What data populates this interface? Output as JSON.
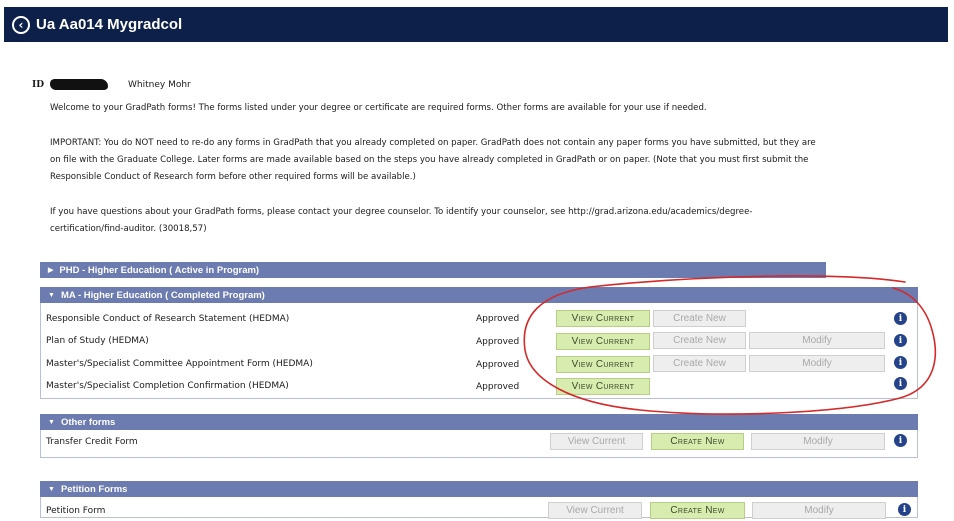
{
  "app": {
    "title": "Ua Aa014 Mygradcol"
  },
  "identity": {
    "id_label": "ID",
    "name": "Whitney Mohr"
  },
  "intro": {
    "welcome": "Welcome to your GradPath forms! The forms listed under your degree or certificate are required forms. Other forms are available for your use if needed.",
    "important": "IMPORTANT: You do NOT need to re-do any forms in GradPath that you already completed on paper. GradPath does not contain any paper forms you have submitted, but they are on file with the Graduate College. Later forms are made available based on the steps you have already completed in GradPath or on paper. (Note that you must first submit the Responsible Conduct of Research form before other required forms will be available.)",
    "questions": "If you have questions about your GradPath forms, please contact your degree counselor. To identify your counselor, see http://grad.arizona.edu/academics/degree-certification/find-auditor. (30018,57)"
  },
  "sections": {
    "phd": {
      "label": "PHD - Higher Education ( Active in Program)"
    },
    "ma": {
      "label": "MA - Higher Education ( Completed Program)",
      "rows": [
        {
          "name": "Responsible Conduct of Research Statement (HEDMA)",
          "status": "Approved",
          "view": "View Current",
          "create": "Create New"
        },
        {
          "name": "Plan of Study (HEDMA)",
          "status": "Approved",
          "view": "View Current",
          "create": "Create New",
          "modify": "Modify"
        },
        {
          "name": "Master's/Specialist Committee Appointment Form (HEDMA)",
          "status": "Approved",
          "view": "View Current",
          "create": "Create New",
          "modify": "Modify"
        },
        {
          "name": "Master's/Specialist Completion Confirmation (HEDMA)",
          "status": "Approved",
          "view": "View Current"
        }
      ]
    },
    "other": {
      "label": "Other forms",
      "rows": [
        {
          "name": "Transfer Credit Form",
          "view": "View Current",
          "create": "Create New",
          "modify": "Modify"
        }
      ]
    },
    "petition": {
      "label": "Petition Forms",
      "rows": [
        {
          "name": "Petition Form",
          "view": "View Current",
          "create": "Create New",
          "modify": "Modify"
        }
      ]
    }
  },
  "colors": {
    "titlebar": "#0c2049",
    "section_header": "#6c7bb0",
    "button_active": "#d9ecaf",
    "annotation": "#d42a2a"
  }
}
